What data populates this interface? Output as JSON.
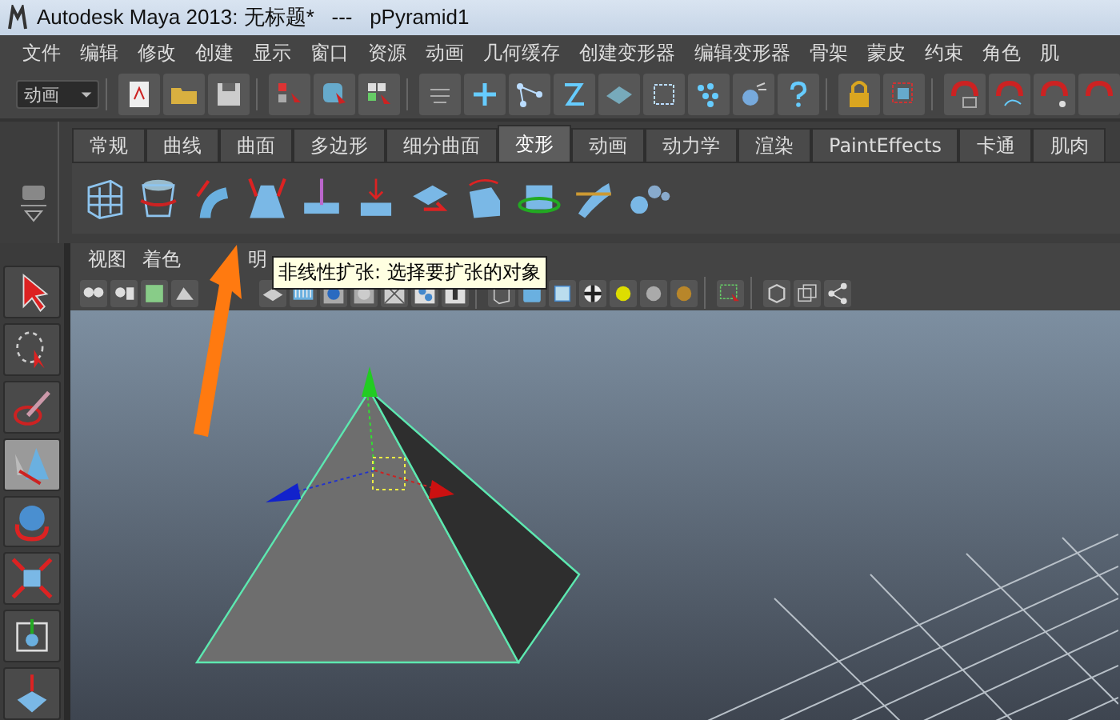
{
  "window": {
    "title": "Autodesk Maya 2013: 无标题*   ---   pPyramid1"
  },
  "menu_bar": [
    "文件",
    "编辑",
    "修改",
    "创建",
    "显示",
    "窗口",
    "资源",
    "动画",
    "几何缓存",
    "创建变形器",
    "编辑变形器",
    "骨架",
    "蒙皮",
    "约束",
    "角色",
    "肌"
  ],
  "menu_set": {
    "value": "动画"
  },
  "shelf_tabs": [
    {
      "label": "常规",
      "selected": false
    },
    {
      "label": "曲线",
      "selected": false
    },
    {
      "label": "曲面",
      "selected": false
    },
    {
      "label": "多边形",
      "selected": false
    },
    {
      "label": "细分曲面",
      "selected": false
    },
    {
      "label": "变形",
      "selected": true
    },
    {
      "label": "动画",
      "selected": false
    },
    {
      "label": "动力学",
      "selected": false
    },
    {
      "label": "渲染",
      "selected": false
    },
    {
      "label": "PaintEffects",
      "selected": false
    },
    {
      "label": "卡通",
      "selected": false
    },
    {
      "label": "肌肉",
      "selected": false
    }
  ],
  "toolbox": [
    {
      "selected": false
    },
    {
      "selected": false
    },
    {
      "selected": false
    },
    {
      "selected": true
    },
    {
      "selected": false
    },
    {
      "selected": false
    },
    {
      "selected": false
    },
    {
      "selected": false
    }
  ],
  "panel_menu": [
    "视图",
    "着色",
    "明"
  ],
  "tooltip": {
    "text": "非线性扩张: 选择要扩张的对象"
  }
}
